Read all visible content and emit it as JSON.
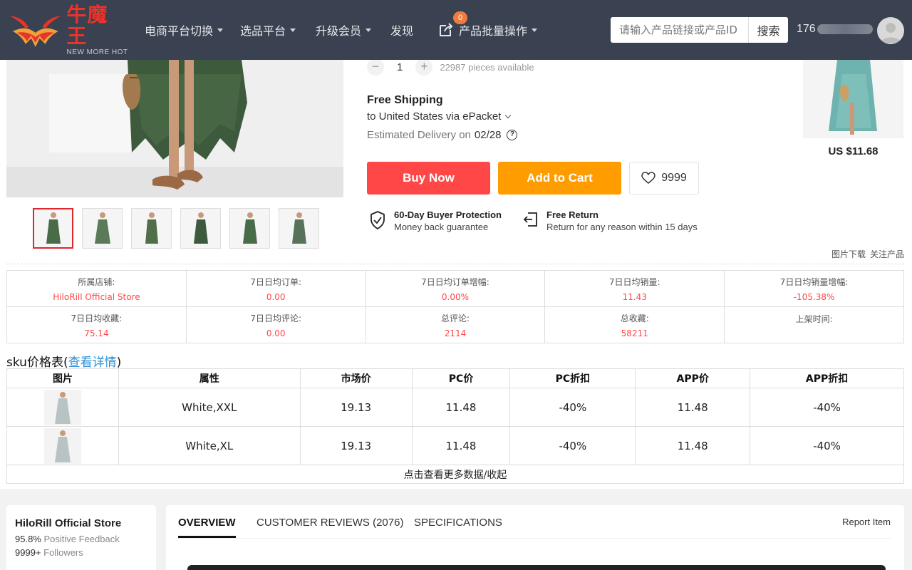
{
  "nav": {
    "logo_cn": "牛魔王",
    "logo_en": "NEW MORE HOT",
    "items": [
      {
        "label": "电商平台切换"
      },
      {
        "label": "选品平台"
      },
      {
        "label": "升级会员"
      },
      {
        "label": "发现"
      },
      {
        "label": "产品批量操作"
      }
    ],
    "badge_count": "0",
    "search_placeholder": "请输入产品链接或产品ID",
    "search_button": "搜索",
    "user_id_prefix": "176"
  },
  "product": {
    "quantity": "1",
    "qty_minus": "−",
    "qty_plus": "+",
    "pieces_available": "22987 pieces available",
    "shipping_title": "Free Shipping",
    "shipping_via": "to United States via ePacket",
    "delivery_label": "Estimated Delivery on",
    "delivery_date": "02/28",
    "buy_now": "Buy Now",
    "add_to_cart": "Add to Cart",
    "wishlist_count": "9999",
    "protection_title": "60-Day Buyer Protection",
    "protection_sub": "Money back guarantee",
    "return_title": "Free Return",
    "return_sub": "Return for any reason within 15 days",
    "side_price": "US $11.68",
    "image_download": "图片下载",
    "follow_product": "关注产品"
  },
  "stats": [
    {
      "label": "所属店铺:",
      "value": "HiloRill Official Store"
    },
    {
      "label": "7日日均订单:",
      "value": "0.00"
    },
    {
      "label": "7日日均订单增幅:",
      "value": "0.00%"
    },
    {
      "label": "7日日均销量:",
      "value": "11.43"
    },
    {
      "label": "7日日均销量增幅:",
      "value": "-105.38%"
    },
    {
      "label": "7日日均收藏:",
      "value": "75.14"
    },
    {
      "label": "7日日均评论:",
      "value": "0.00"
    },
    {
      "label": "总评论:",
      "value": "2114"
    },
    {
      "label": "总收藏:",
      "value": "58211"
    },
    {
      "label": "上架时间:",
      "value": ""
    }
  ],
  "sku": {
    "title": "sku价格表(",
    "link": "查看详情",
    "title_end": ")",
    "headers": [
      "图片",
      "属性",
      "市场价",
      "PC价",
      "PC折扣",
      "APP价",
      "APP折扣"
    ],
    "rows": [
      {
        "attr": "White,XXL",
        "market": "19.13",
        "pc": "11.48",
        "pc_disc": "-40%",
        "app": "11.48",
        "app_disc": "-40%"
      },
      {
        "attr": "White,XL",
        "market": "19.13",
        "pc": "11.48",
        "pc_disc": "-40%",
        "app": "11.48",
        "app_disc": "-40%"
      }
    ],
    "more": "点击查看更多数据/收起"
  },
  "store": {
    "name": "HiloRill Official Store",
    "feedback_value": "95.8%",
    "feedback_label": "Positive Feedback",
    "followers_value": "9999+",
    "followers_label": "Followers"
  },
  "tabs": {
    "overview": "OVERVIEW",
    "reviews": "CUSTOMER REVIEWS (2076)",
    "specs": "SPECIFICATIONS",
    "report": "Report Item"
  },
  "colors": {
    "nav_bg": "#3a4150",
    "buy": "#ff4747",
    "cart": "#ff9c00",
    "stat_value": "#ff4747",
    "link": "#2a8fd6"
  }
}
